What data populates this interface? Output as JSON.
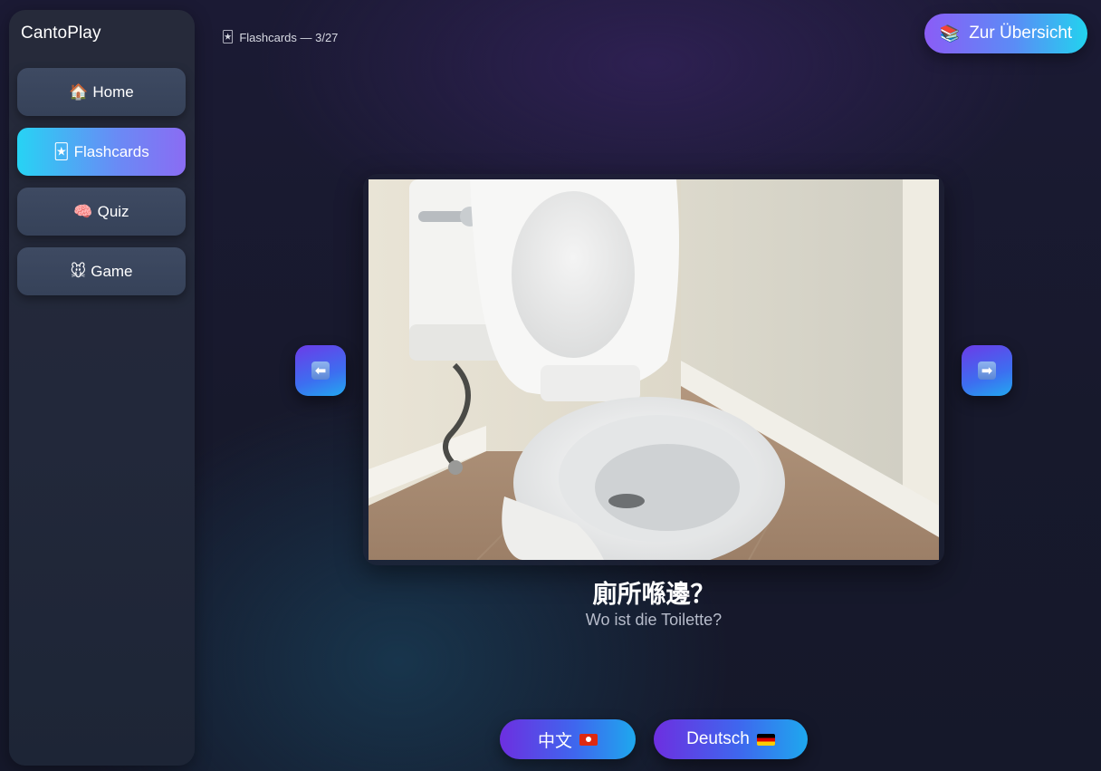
{
  "app": {
    "title": "CantoPlay"
  },
  "sidebar": {
    "items": [
      {
        "emoji": "🏠",
        "label": "Home",
        "active": false
      },
      {
        "emoji": "🃏",
        "label": "Flashcards",
        "active": true
      },
      {
        "emoji": "🧠",
        "label": "Quiz",
        "active": false
      },
      {
        "emoji": "🐭",
        "label": "Game",
        "active": false
      }
    ]
  },
  "header": {
    "crumb_emoji": "🃏",
    "crumb_label": "Flashcards — 3/27",
    "overview_emoji": "📚",
    "overview_label": "Zur Übersicht"
  },
  "card": {
    "image_icon": "toilet-photo",
    "phrase_zh": "廁所喺邊？",
    "phrase_de": "Wo ist die Toilette?"
  },
  "nav_arrows": {
    "prev_glyph": "⬅",
    "next_glyph": "➡"
  },
  "language_buttons": {
    "zh_label": "中文",
    "de_label": "Deutsch"
  },
  "colors": {
    "accent_start": "#22d3ee",
    "accent_end": "#8b5cf6",
    "sidebar_item": "#3e4a62"
  }
}
